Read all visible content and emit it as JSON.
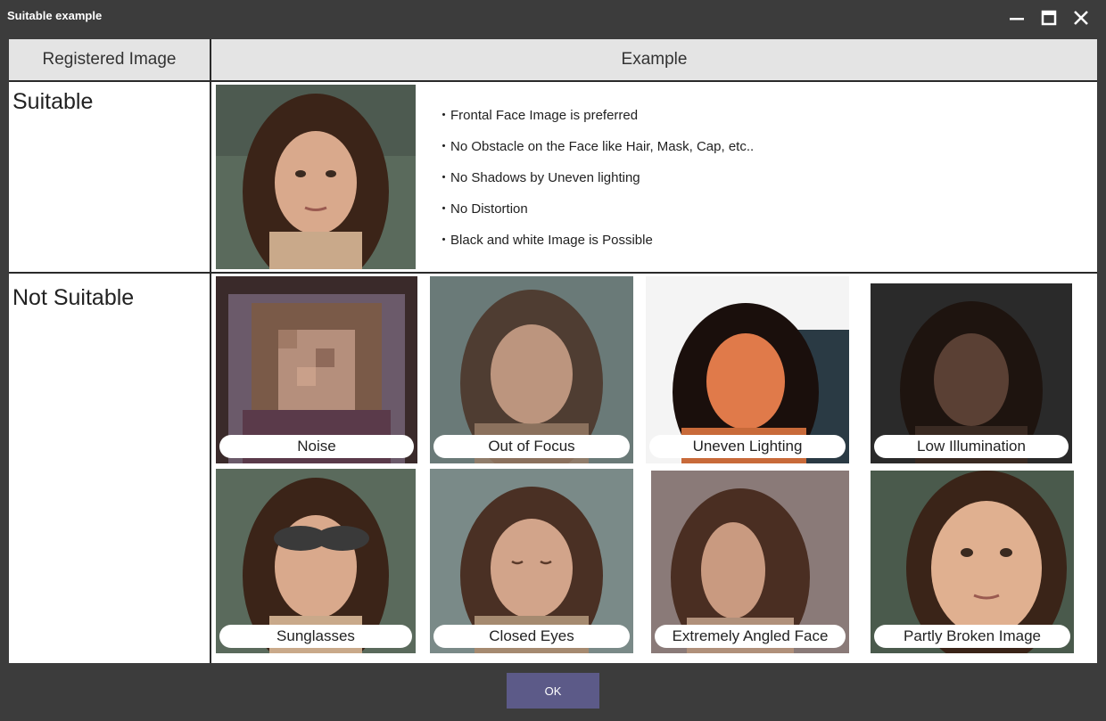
{
  "window": {
    "title": "Suitable example"
  },
  "table": {
    "header_left": "Registered Image",
    "header_right": "Example",
    "row_suitable_label": "Suitable",
    "row_not_suitable_label": "Not Suitable"
  },
  "suitable": {
    "bullets": [
      "Frontal Face Image is preferred",
      "No Obstacle on the Face like Hair, Mask, Cap, etc..",
      "No Shadows by Uneven lighting",
      "No Distortion",
      "Black and white Image is Possible"
    ]
  },
  "not_suitable": {
    "examples": [
      {
        "label": "Noise"
      },
      {
        "label": "Out of Focus"
      },
      {
        "label": "Uneven Lighting"
      },
      {
        "label": "Low Illumination"
      },
      {
        "label": "Sunglasses"
      },
      {
        "label": "Closed Eyes"
      },
      {
        "label": "Extremely Angled Face"
      },
      {
        "label": "Partly Broken Image"
      }
    ]
  },
  "footer": {
    "ok_label": "OK"
  },
  "colors": {
    "chrome": "#3c3c3c",
    "header_bg": "#e4e4e4",
    "ok_button": "#5c5a88"
  }
}
